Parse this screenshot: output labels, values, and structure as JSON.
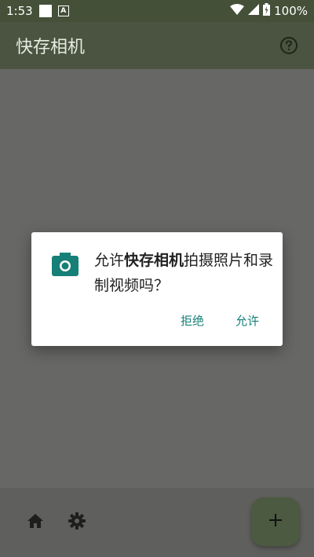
{
  "status_bar": {
    "time": "1:53",
    "a_badge": "A",
    "battery": "100%"
  },
  "app_bar": {
    "title": "快存相机"
  },
  "dialog": {
    "msg_prefix": "允许",
    "app_name": "快存相机",
    "msg_suffix": "拍摄照片和录制视频吗？",
    "deny_label": "拒绝",
    "allow_label": "允许"
  },
  "fab": {
    "label": "+"
  },
  "colors": {
    "accent": "#157f78",
    "app_bar": "#4a5440",
    "background": "#676765"
  }
}
